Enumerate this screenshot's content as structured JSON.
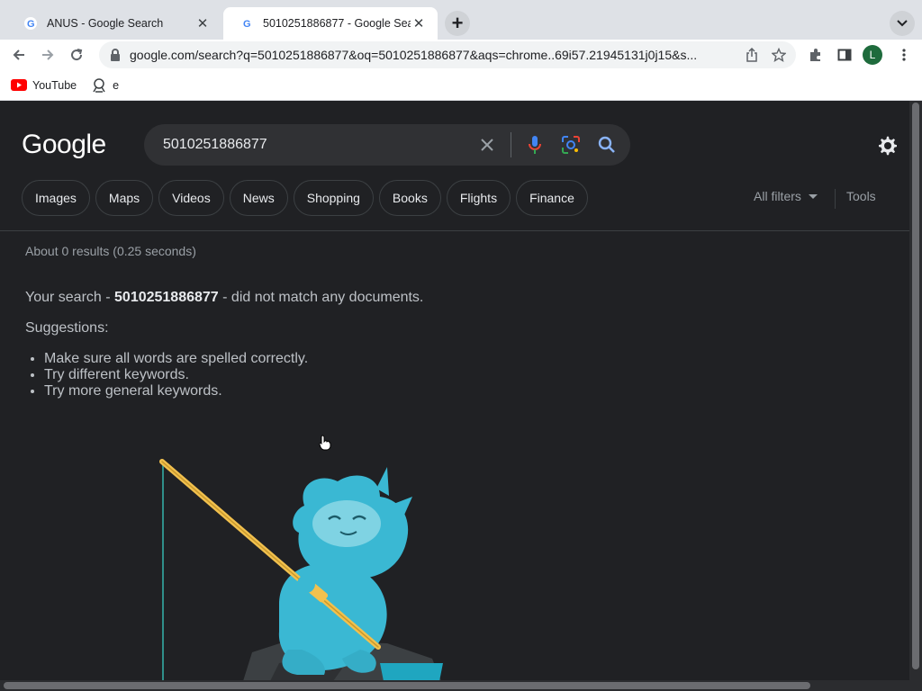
{
  "browser": {
    "tabs": [
      {
        "title": "ANUS - Google Search",
        "active": false
      },
      {
        "title": "5010251886877 - Google Sear",
        "active": true
      }
    ],
    "url": "google.com/search?q=5010251886877&oq=5010251886877&aqs=chrome..69i57.21945131j0j15&s...",
    "profile_initial": "L",
    "bookmarks": [
      {
        "label": "YouTube",
        "icon": "youtube-icon"
      },
      {
        "label": "e",
        "icon": "extension-bookmark-icon"
      }
    ]
  },
  "search": {
    "logo": "Google",
    "query": "5010251886877",
    "chips": [
      "Images",
      "Maps",
      "Videos",
      "News",
      "Shopping",
      "Books",
      "Flights",
      "Finance"
    ],
    "all_filters": "All filters",
    "tools": "Tools",
    "stats": "About 0 results (0.25 seconds)",
    "no_match_prefix": "Your search - ",
    "no_match_query": "5010251886877",
    "no_match_suffix": " - did not match any documents.",
    "suggestions_title": "Suggestions:",
    "suggestions": [
      "Make sure all words are spelled correctly.",
      "Try different keywords.",
      "Try more general keywords."
    ]
  },
  "colors": {
    "page_bg": "#202124",
    "accent_blue": "#8ab4f8",
    "mascot": "#3ab8d3"
  }
}
